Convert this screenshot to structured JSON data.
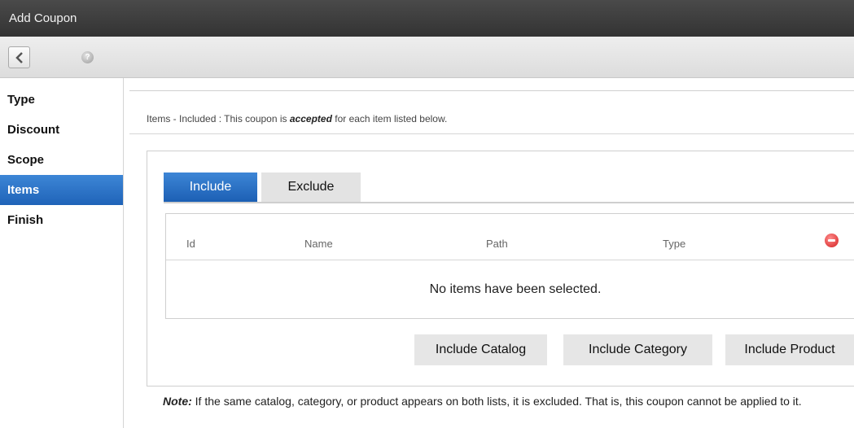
{
  "window": {
    "title": "Add Coupon"
  },
  "toolbar": {
    "back_icon": "chevron-left-icon",
    "help_icon": "help-icon",
    "help_glyph": "?"
  },
  "sidebar": {
    "items": [
      {
        "label": "Type",
        "active": false
      },
      {
        "label": "Discount",
        "active": false
      },
      {
        "label": "Scope",
        "active": false
      },
      {
        "label": "Items",
        "active": true
      },
      {
        "label": "Finish",
        "active": false
      }
    ]
  },
  "main": {
    "intro": {
      "prefix": "Items - Included : This coupon is ",
      "emphasis": "accepted",
      "suffix": " for each item listed below."
    },
    "tabs": [
      {
        "label": "Include",
        "active": true
      },
      {
        "label": "Exclude",
        "active": false
      }
    ],
    "table": {
      "columns": [
        "Id",
        "Name",
        "Path",
        "Type"
      ],
      "remove_icon": "remove-icon",
      "empty_message": "No items have been selected."
    },
    "buttons": {
      "include_catalog": "Include Catalog",
      "include_category": "Include Category",
      "include_product": "Include Product"
    },
    "note": {
      "label": "Note:",
      "text": " If the same catalog, category, or product appears on both lists, it is excluded. That is, this coupon cannot be applied to it."
    }
  },
  "colors": {
    "accent": "#2a73c8",
    "titlebar": "#3c3c3c",
    "remove": "#d42020"
  }
}
